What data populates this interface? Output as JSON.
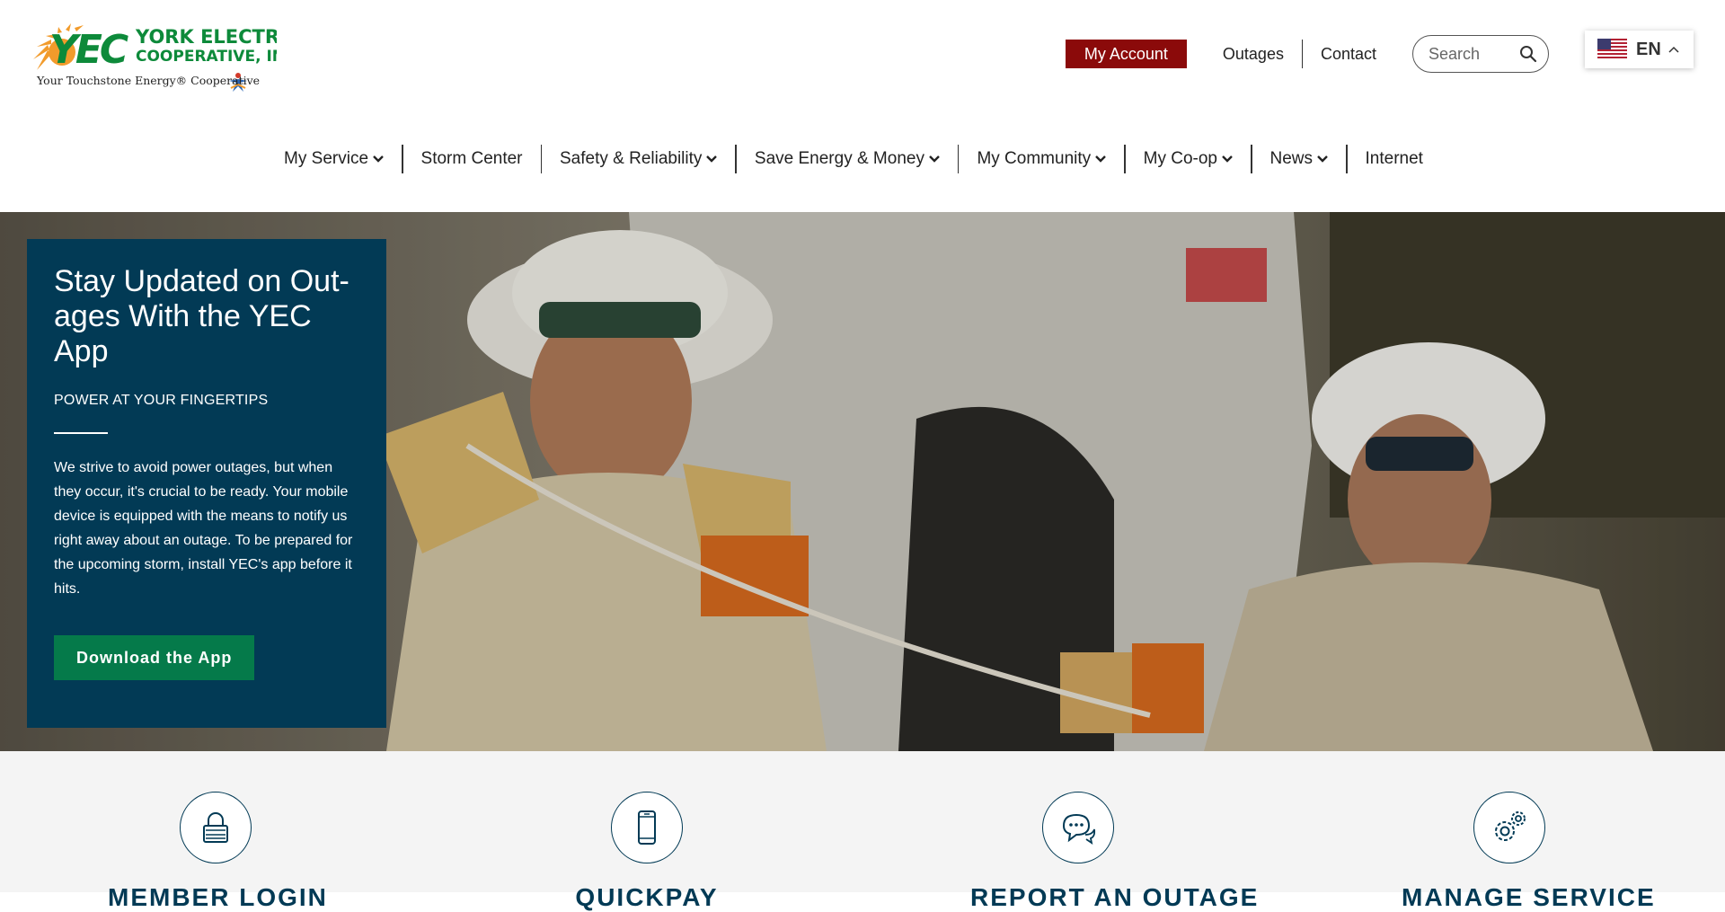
{
  "brand": {
    "logo_mark": "YEC",
    "name_line1": "YORK ELECTRIC",
    "name_line2": "COOPERATIVE, INC.",
    "tagline": "Your Touchstone Energy® Cooperative",
    "colors": {
      "green": "#0d8a3a",
      "orange": "#f29b2b",
      "navy": "#023a55",
      "red": "#8b0a0a"
    }
  },
  "utility_nav": {
    "account_label": "My Account",
    "outages_label": "Outages",
    "contact_label": "Contact",
    "search_placeholder": "Search",
    "search_icon": "search-icon"
  },
  "language": {
    "code": "EN",
    "flag_icon": "us-flag-icon",
    "caret_icon": "chevron-up-icon"
  },
  "main_nav": {
    "items": [
      {
        "label": "My Service",
        "has_dropdown": true
      },
      {
        "label": "Storm Center",
        "has_dropdown": false
      },
      {
        "label": "Safety & Reliability",
        "has_dropdown": true
      },
      {
        "label": "Save Energy & Money",
        "has_dropdown": true
      },
      {
        "label": "My Community",
        "has_dropdown": true
      },
      {
        "label": "My Co-op",
        "has_dropdown": true
      },
      {
        "label": "News",
        "has_dropdown": true
      },
      {
        "label": "Internet",
        "has_dropdown": false
      }
    ]
  },
  "hero": {
    "title": "Stay Updated on Out­ages With the YEC App",
    "eyebrow": "POWER AT YOUR FINGERTIPS",
    "body": "We strive to avoid power outages, but when they occur, it's crucial to be ready. Your mobile device is equipped with the means to notify us right away about an outage. To be pre­pared for the upcoming storm, install YEC's app before it hits.",
    "cta_label": "Download the App",
    "image_alt": "Two lineworkers in hard hats and safety glasses pulling a cable beside a utility truck"
  },
  "quick_links": [
    {
      "label": "MEMBER LOGIN",
      "icon": "lock-icon"
    },
    {
      "label": "QUICKPAY",
      "icon": "mobile-phone-icon"
    },
    {
      "label": "REPORT AN OUTAGE",
      "icon": "chat-bubbles-icon"
    },
    {
      "label": "MANAGE SERVICE",
      "icon": "gears-icon"
    }
  ]
}
